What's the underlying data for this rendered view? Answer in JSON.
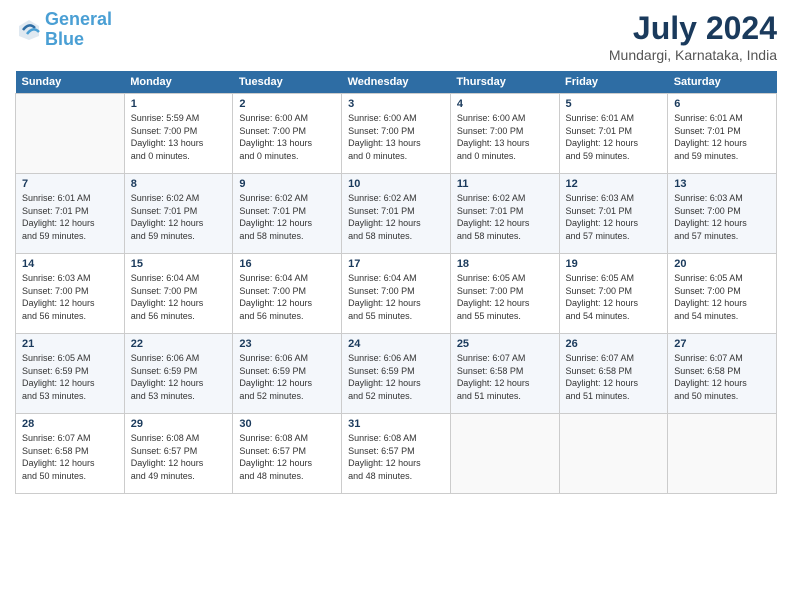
{
  "header": {
    "logo_line1": "General",
    "logo_line2": "Blue",
    "month_year": "July 2024",
    "location": "Mundargi, Karnataka, India"
  },
  "days_of_week": [
    "Sunday",
    "Monday",
    "Tuesday",
    "Wednesday",
    "Thursday",
    "Friday",
    "Saturday"
  ],
  "weeks": [
    [
      {
        "day": "",
        "info": ""
      },
      {
        "day": "1",
        "info": "Sunrise: 5:59 AM\nSunset: 7:00 PM\nDaylight: 13 hours\nand 0 minutes."
      },
      {
        "day": "2",
        "info": "Sunrise: 6:00 AM\nSunset: 7:00 PM\nDaylight: 13 hours\nand 0 minutes."
      },
      {
        "day": "3",
        "info": "Sunrise: 6:00 AM\nSunset: 7:00 PM\nDaylight: 13 hours\nand 0 minutes."
      },
      {
        "day": "4",
        "info": "Sunrise: 6:00 AM\nSunset: 7:00 PM\nDaylight: 13 hours\nand 0 minutes."
      },
      {
        "day": "5",
        "info": "Sunrise: 6:01 AM\nSunset: 7:01 PM\nDaylight: 12 hours\nand 59 minutes."
      },
      {
        "day": "6",
        "info": "Sunrise: 6:01 AM\nSunset: 7:01 PM\nDaylight: 12 hours\nand 59 minutes."
      }
    ],
    [
      {
        "day": "7",
        "info": "Sunrise: 6:01 AM\nSunset: 7:01 PM\nDaylight: 12 hours\nand 59 minutes."
      },
      {
        "day": "8",
        "info": "Sunrise: 6:02 AM\nSunset: 7:01 PM\nDaylight: 12 hours\nand 59 minutes."
      },
      {
        "day": "9",
        "info": "Sunrise: 6:02 AM\nSunset: 7:01 PM\nDaylight: 12 hours\nand 58 minutes."
      },
      {
        "day": "10",
        "info": "Sunrise: 6:02 AM\nSunset: 7:01 PM\nDaylight: 12 hours\nand 58 minutes."
      },
      {
        "day": "11",
        "info": "Sunrise: 6:02 AM\nSunset: 7:01 PM\nDaylight: 12 hours\nand 58 minutes."
      },
      {
        "day": "12",
        "info": "Sunrise: 6:03 AM\nSunset: 7:01 PM\nDaylight: 12 hours\nand 57 minutes."
      },
      {
        "day": "13",
        "info": "Sunrise: 6:03 AM\nSunset: 7:00 PM\nDaylight: 12 hours\nand 57 minutes."
      }
    ],
    [
      {
        "day": "14",
        "info": "Sunrise: 6:03 AM\nSunset: 7:00 PM\nDaylight: 12 hours\nand 56 minutes."
      },
      {
        "day": "15",
        "info": "Sunrise: 6:04 AM\nSunset: 7:00 PM\nDaylight: 12 hours\nand 56 minutes."
      },
      {
        "day": "16",
        "info": "Sunrise: 6:04 AM\nSunset: 7:00 PM\nDaylight: 12 hours\nand 56 minutes."
      },
      {
        "day": "17",
        "info": "Sunrise: 6:04 AM\nSunset: 7:00 PM\nDaylight: 12 hours\nand 55 minutes."
      },
      {
        "day": "18",
        "info": "Sunrise: 6:05 AM\nSunset: 7:00 PM\nDaylight: 12 hours\nand 55 minutes."
      },
      {
        "day": "19",
        "info": "Sunrise: 6:05 AM\nSunset: 7:00 PM\nDaylight: 12 hours\nand 54 minutes."
      },
      {
        "day": "20",
        "info": "Sunrise: 6:05 AM\nSunset: 7:00 PM\nDaylight: 12 hours\nand 54 minutes."
      }
    ],
    [
      {
        "day": "21",
        "info": "Sunrise: 6:05 AM\nSunset: 6:59 PM\nDaylight: 12 hours\nand 53 minutes."
      },
      {
        "day": "22",
        "info": "Sunrise: 6:06 AM\nSunset: 6:59 PM\nDaylight: 12 hours\nand 53 minutes."
      },
      {
        "day": "23",
        "info": "Sunrise: 6:06 AM\nSunset: 6:59 PM\nDaylight: 12 hours\nand 52 minutes."
      },
      {
        "day": "24",
        "info": "Sunrise: 6:06 AM\nSunset: 6:59 PM\nDaylight: 12 hours\nand 52 minutes."
      },
      {
        "day": "25",
        "info": "Sunrise: 6:07 AM\nSunset: 6:58 PM\nDaylight: 12 hours\nand 51 minutes."
      },
      {
        "day": "26",
        "info": "Sunrise: 6:07 AM\nSunset: 6:58 PM\nDaylight: 12 hours\nand 51 minutes."
      },
      {
        "day": "27",
        "info": "Sunrise: 6:07 AM\nSunset: 6:58 PM\nDaylight: 12 hours\nand 50 minutes."
      }
    ],
    [
      {
        "day": "28",
        "info": "Sunrise: 6:07 AM\nSunset: 6:58 PM\nDaylight: 12 hours\nand 50 minutes."
      },
      {
        "day": "29",
        "info": "Sunrise: 6:08 AM\nSunset: 6:57 PM\nDaylight: 12 hours\nand 49 minutes."
      },
      {
        "day": "30",
        "info": "Sunrise: 6:08 AM\nSunset: 6:57 PM\nDaylight: 12 hours\nand 48 minutes."
      },
      {
        "day": "31",
        "info": "Sunrise: 6:08 AM\nSunset: 6:57 PM\nDaylight: 12 hours\nand 48 minutes."
      },
      {
        "day": "",
        "info": ""
      },
      {
        "day": "",
        "info": ""
      },
      {
        "day": "",
        "info": ""
      }
    ]
  ]
}
